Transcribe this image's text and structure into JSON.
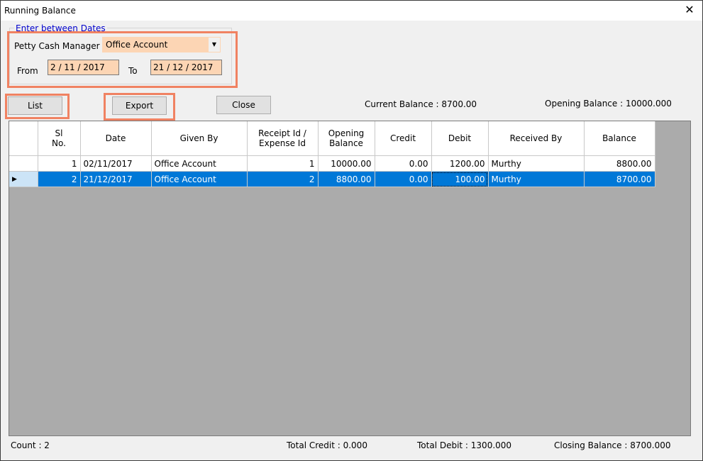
{
  "window": {
    "title": "Running Balance",
    "close_glyph": "✕"
  },
  "filter": {
    "group_label": "Enter between Dates",
    "manager_label": "Petty Cash Manager",
    "manager_value": "Office Account",
    "from_label": "From",
    "from_value": "2 / 11 / 2017",
    "to_label": "To",
    "to_value": "21 / 12 / 2017"
  },
  "buttons": {
    "list": "List",
    "export": "Export",
    "close": "Close"
  },
  "balances": {
    "current": "Current Balance : 8700.00",
    "opening": "Opening Balance : 10000.000"
  },
  "table": {
    "columns": [
      "Sl\nNo.",
      "Date",
      "Given By",
      "Receipt Id /\nExpense Id",
      "Opening\nBalance",
      "Credit",
      "Debit",
      "Received By",
      "Balance"
    ],
    "rows": [
      {
        "sl": "1",
        "date": "02/11/2017",
        "given_by": "Office Account",
        "id": "1",
        "opening": "10000.00",
        "credit": "0.00",
        "debit": "1200.00",
        "received_by": "Murthy",
        "balance": "8800.00"
      },
      {
        "sl": "2",
        "date": "21/12/2017",
        "given_by": "Office Account",
        "id": "2",
        "opening": "8800.00",
        "credit": "0.00",
        "debit": "100.00",
        "received_by": "Murthy",
        "balance": "8700.00"
      }
    ],
    "current_row_glyph": "▶"
  },
  "footer": {
    "count": "Count : 2",
    "total_credit": "Total Credit : 0.000",
    "total_debit": "Total Debit : 1300.000",
    "closing_balance": "Closing Balance : 8700.000"
  },
  "colors": {
    "highlight": "#f08262",
    "input_bg": "#fcd5b4",
    "selection": "#0078d7",
    "grid_bg": "#ababab"
  }
}
